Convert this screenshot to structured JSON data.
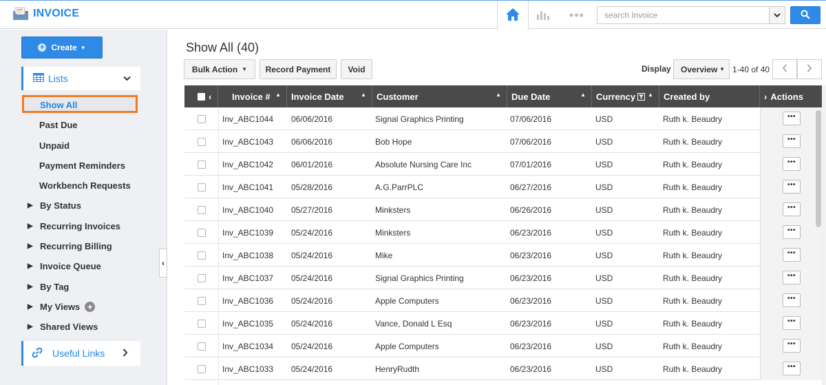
{
  "app": {
    "title": "INVOICE",
    "brand_color": "#1b87e6",
    "accent_color": "#2e8ae6",
    "active_outline": "#f07b23",
    "icon": "envelope-invoice-icon"
  },
  "topnav": {
    "home_icon": "home-icon",
    "reports_icon": "bar-chart-icon",
    "more_icon": "more-dots-icon",
    "more_label": "•••",
    "search_placeholder": "search Invoice",
    "search_icon": "search-icon"
  },
  "sidebar": {
    "create_label": "Create",
    "lists_label": "Lists",
    "active_item": "Show All",
    "items": [
      "Past Due",
      "Unpaid",
      "Payment Reminders",
      "Workbench Requests"
    ],
    "groups": [
      "By Status",
      "Recurring Invoices",
      "Recurring Billing",
      "Invoice Queue",
      "By Tag",
      "My Views",
      "Shared Views"
    ],
    "my_views_add": "+",
    "useful_links_label": "Useful Links"
  },
  "main": {
    "title": "Show All (40)",
    "toolbar": {
      "bulk_action": "Bulk Action",
      "record_payment": "Record Payment",
      "void": "Void"
    },
    "display_label": "Display",
    "display_value": "Overview",
    "pager_text": "1-40 of 40"
  },
  "table": {
    "columns": [
      "Invoice #",
      "Invoice Date",
      "Customer",
      "Due Date",
      "Currency",
      "Created by",
      "Actions"
    ],
    "rows": [
      {
        "invoice": "Inv_ABC1044",
        "date": "06/06/2016",
        "customer": "Signal Graphics Printing",
        "due": "07/06/2016",
        "currency": "USD",
        "created_by": "Ruth k. Beaudry"
      },
      {
        "invoice": "Inv_ABC1043",
        "date": "06/06/2016",
        "customer": "Bob Hope",
        "due": "07/06/2016",
        "currency": "USD",
        "created_by": "Ruth k. Beaudry"
      },
      {
        "invoice": "Inv_ABC1042",
        "date": "06/01/2016",
        "customer": "Absolute Nursing Care Inc",
        "due": "07/01/2016",
        "currency": "USD",
        "created_by": "Ruth k. Beaudry"
      },
      {
        "invoice": "Inv_ABC1041",
        "date": "05/28/2016",
        "customer": "A.G.ParrPLC",
        "due": "06/27/2016",
        "currency": "USD",
        "created_by": "Ruth k. Beaudry"
      },
      {
        "invoice": "Inv_ABC1040",
        "date": "05/27/2016",
        "customer": "Minksters",
        "due": "06/26/2016",
        "currency": "USD",
        "created_by": "Ruth k. Beaudry"
      },
      {
        "invoice": "Inv_ABC1039",
        "date": "05/24/2016",
        "customer": "Minksters",
        "due": "06/23/2016",
        "currency": "USD",
        "created_by": "Ruth k. Beaudry"
      },
      {
        "invoice": "Inv_ABC1038",
        "date": "05/24/2016",
        "customer": "Mike",
        "due": "06/23/2016",
        "currency": "USD",
        "created_by": "Ruth k. Beaudry"
      },
      {
        "invoice": "Inv_ABC1037",
        "date": "05/24/2016",
        "customer": "Signal Graphics Printing",
        "due": "06/23/2016",
        "currency": "USD",
        "created_by": "Ruth k. Beaudry"
      },
      {
        "invoice": "Inv_ABC1036",
        "date": "05/24/2016",
        "customer": "Apple Computers",
        "due": "06/23/2016",
        "currency": "USD",
        "created_by": "Ruth k. Beaudry"
      },
      {
        "invoice": "Inv_ABC1035",
        "date": "05/24/2016",
        "customer": "Vance, Donald L Esq",
        "due": "06/23/2016",
        "currency": "USD",
        "created_by": "Ruth k. Beaudry"
      },
      {
        "invoice": "Inv_ABC1034",
        "date": "05/24/2016",
        "customer": "Apple Computers",
        "due": "06/23/2016",
        "currency": "USD",
        "created_by": "Ruth k. Beaudry"
      },
      {
        "invoice": "Inv_ABC1033",
        "date": "05/24/2016",
        "customer": "HenryRudth",
        "due": "06/23/2016",
        "currency": "USD",
        "created_by": "Ruth k. Beaudry"
      }
    ],
    "row_action_label": "•••"
  }
}
